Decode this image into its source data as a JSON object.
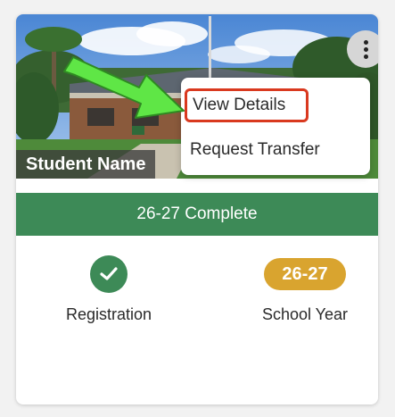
{
  "student": {
    "name": "Student Name"
  },
  "menu": {
    "items": [
      {
        "label": "View Details"
      },
      {
        "label": "Request Transfer"
      }
    ]
  },
  "status": {
    "text": "26-27 Complete"
  },
  "stats": {
    "registration": {
      "label": "Registration",
      "icon": "checkmark-icon"
    },
    "school_year": {
      "badge": "26-27",
      "label": "School Year"
    }
  },
  "colors": {
    "green": "#3d8a57",
    "gold": "#d9a42f",
    "highlight": "#d9391f",
    "arrow": "#5fe646"
  }
}
